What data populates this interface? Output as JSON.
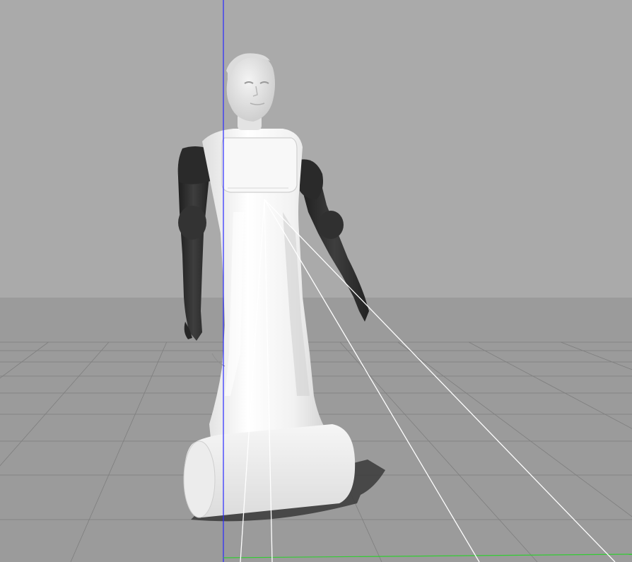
{
  "viewport": {
    "type": "3d-simulation-view",
    "background_color": "#aaaaaa",
    "ground_color": "#9a9a9a",
    "grid_color": "#7e7e7e",
    "axis_z_color": "#2a2aff",
    "axis_x_color": "#33cc33",
    "grid": true
  },
  "robot": {
    "name": "humanoid-robot",
    "shell_color": "#f4f4f4",
    "arm_color": "#2d2d2d"
  },
  "sensor_rays": {
    "count": 4,
    "color": "#ffffff"
  },
  "text_labels": []
}
